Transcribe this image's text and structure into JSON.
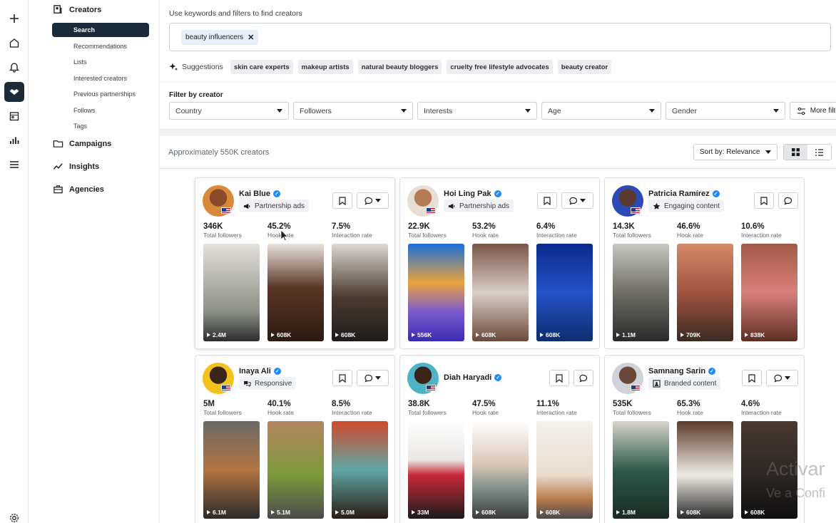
{
  "rail": {
    "icons": [
      "plus-icon",
      "home-icon",
      "bell-icon",
      "handshake-icon",
      "calendar-icon",
      "bar-chart-icon",
      "menu-icon",
      "gear-icon"
    ]
  },
  "nav": {
    "creators": "Creators",
    "sub_items": [
      "Search",
      "Recommendations",
      "Lists",
      "Interested creators",
      "Previous partnerships",
      "Follows",
      "Tags"
    ],
    "campaigns": "Campaigns",
    "insights": "Insights",
    "agencies": "Agencies"
  },
  "search": {
    "hint": "Use keywords and filters to find creators",
    "chip": "beauty influencers",
    "suggestions_label": "Suggestions",
    "suggestions": [
      "skin care experts",
      "makeup artists",
      "natural beauty bloggers",
      "cruelty free lifestyle advocates",
      "beauty creator"
    ],
    "filter_title": "Filter by creator",
    "filters": [
      "Country",
      "Followers",
      "Interests",
      "Age",
      "Gender"
    ],
    "more_filters": "More filters"
  },
  "results": {
    "count": "Approximately 550K creators",
    "sort": "Sort by: Relevance"
  },
  "labels": {
    "followers": "Total followers",
    "hook": "Hook rate",
    "interaction": "Interaction rate"
  },
  "creators": [
    {
      "name": "Kai Blue",
      "tag": "Partnership ads",
      "tag_icon": "megaphone-icon",
      "followers": "346K",
      "hook": "45.2%",
      "interaction": "7.5%",
      "views": [
        "2.4M",
        "608K",
        "608K"
      ],
      "msg_dropdown": true
    },
    {
      "name": "Hoi Ling Pak",
      "tag": "Partnership ads",
      "tag_icon": "megaphone-icon",
      "followers": "22.9K",
      "hook": "53.2%",
      "interaction": "6.4%",
      "views": [
        "556K",
        "608K",
        "608K"
      ],
      "msg_dropdown": true
    },
    {
      "name": "Patricia Ramírez",
      "tag": "Engaging content",
      "tag_icon": "star-icon",
      "followers": "14.3K",
      "hook": "46.6%",
      "interaction": "10.6%",
      "views": [
        "1.1M",
        "709K",
        "838K"
      ],
      "msg_dropdown": false
    },
    {
      "name": "Inaya Ali",
      "tag": "Responsive",
      "tag_icon": "chat-bubbles-icon",
      "followers": "5M",
      "hook": "40.1%",
      "interaction": "8.5%",
      "views": [
        "6.1M",
        "5.1M",
        "5.0M"
      ],
      "msg_dropdown": true
    },
    {
      "name": "Diah Haryadi",
      "tag": "",
      "tag_icon": "",
      "followers": "38.8K",
      "hook": "47.5%",
      "interaction": "11.1%",
      "views": [
        "33M",
        "608K",
        "608K"
      ],
      "msg_dropdown": false
    },
    {
      "name": "Samnang Sarin",
      "tag": "Branded content",
      "tag_icon": "branded-content-icon",
      "followers": "535K",
      "hook": "65.3%",
      "interaction": "4.6%",
      "views": [
        "1.8M",
        "608K",
        "608K"
      ],
      "msg_dropdown": true
    }
  ],
  "watermark": {
    "line1": "Activar",
    "line2": "Ve a Confi"
  }
}
